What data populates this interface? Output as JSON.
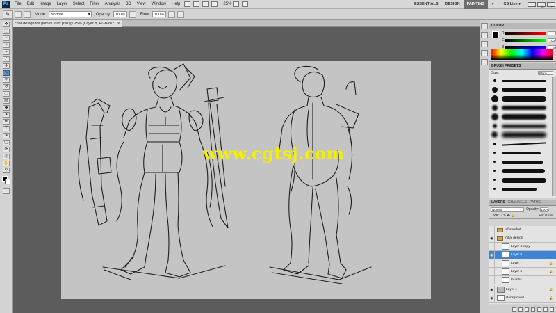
{
  "menubar": {
    "app_icon": "Ps",
    "items": [
      "File",
      "Edit",
      "Image",
      "Layer",
      "Select",
      "Filter",
      "Analysis",
      "3D",
      "View",
      "Window",
      "Help"
    ],
    "zoom": "25%",
    "workspaces": [
      "ESSENTIALS",
      "DESIGN",
      "PAINTING"
    ],
    "active_workspace": "PAINTING",
    "cs_live": "CS Live ▾"
  },
  "options": {
    "mode_label": "Mode:",
    "mode_value": "Normal",
    "opacity_label": "Opacity:",
    "opacity_value": "100%",
    "flow_label": "Flow:",
    "flow_value": "100%"
  },
  "document": {
    "tab_title": "char design for games start.psd @ 25% (Layer 8, RGB/8) *",
    "close": "×"
  },
  "watermark": "www.cgtsj.com",
  "panels": {
    "color_tab": "COLOR",
    "color_channels": [
      {
        "label": "R",
        "value": ""
      },
      {
        "label": "G",
        "value": "100"
      },
      {
        "label": "B",
        "value": "5"
      }
    ],
    "brush_tab": "BRUSH PRESETS",
    "brush_size_label": "Size:",
    "brush_size_value": "65 px",
    "layers_tabs": [
      "LAYERS",
      "CHANNELS",
      "PATHS"
    ],
    "blend_mode": "Normal",
    "opacity_label": "Opacity:",
    "opacity_value": "100%",
    "lock_label": "Lock:",
    "fill_label": "Fill:",
    "fill_value": "100%",
    "layers": [
      {
        "name": "refrshrefref",
        "kind": "folder"
      },
      {
        "name": "initial design",
        "kind": "folder"
      },
      {
        "name": "Layer 4 copy",
        "kind": "layer"
      },
      {
        "name": "Layer 8",
        "kind": "layer",
        "selected": true
      },
      {
        "name": "Layer 7",
        "kind": "layer"
      },
      {
        "name": "Layer 6",
        "kind": "layer"
      },
      {
        "name": "thumbs",
        "kind": "layer"
      },
      {
        "name": "Layer 1",
        "kind": "layer"
      },
      {
        "name": "Background",
        "kind": "layer"
      }
    ]
  },
  "colors": {
    "canvas_bg": "#c4c4c4",
    "workspace_bg": "#5c5c5c",
    "selection": "#3f85d6",
    "watermark": "#f3f000"
  }
}
